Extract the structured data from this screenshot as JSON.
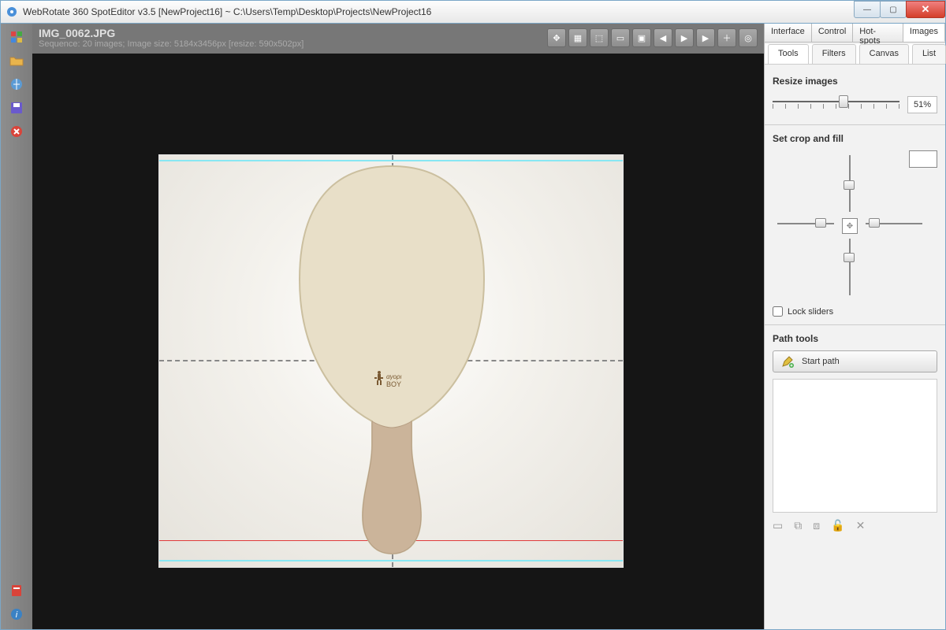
{
  "window": {
    "title": "WebRotate 360 SpotEditor v3.5 [NewProject16] ~ C:\\Users\\Temp\\Desktop\\Projects\\NewProject16"
  },
  "canvas": {
    "image_name": "IMG_0062.JPG",
    "image_meta": "Sequence: 20 images; Image size: 5184x3456px [resize: 590x502px]"
  },
  "top_tabs": [
    "Interface",
    "Control",
    "Hot-spots",
    "Images"
  ],
  "sub_tabs": [
    "Tools",
    "Filters",
    "Canvas",
    "List"
  ],
  "resize": {
    "title": "Resize images",
    "value": "51%"
  },
  "crop": {
    "title": "Set crop and fill",
    "lock_label": "Lock sliders"
  },
  "path": {
    "title": "Path tools",
    "start_label": "Start path"
  }
}
